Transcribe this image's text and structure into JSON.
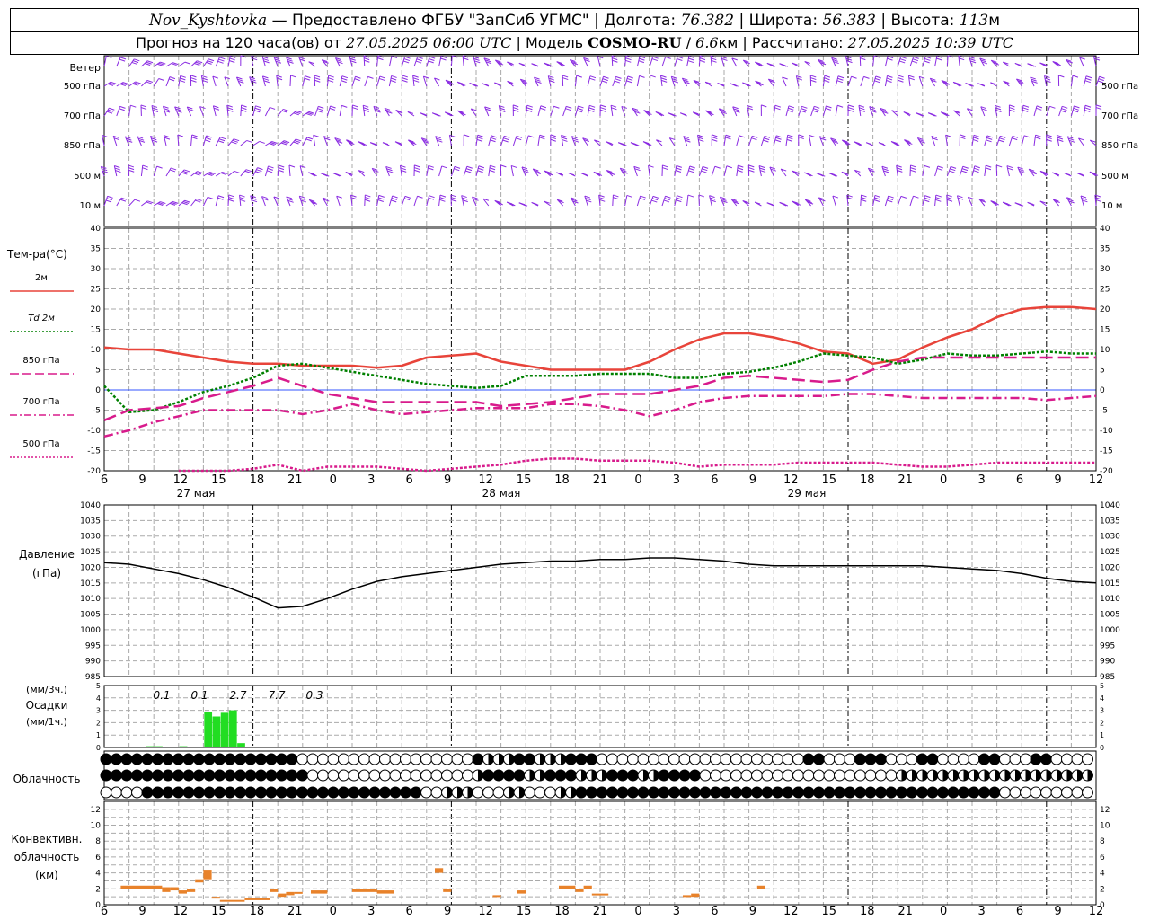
{
  "header": {
    "station": "Nov_Kyshtovka",
    "provider": "Предоставлено ФГБУ \"ЗапСиб УГМС\"",
    "lon_label": "Долгота:",
    "lon_value": "76.382",
    "lat_label": "Широта:",
    "lat_value": "56.383",
    "alt_label": "Высота:",
    "alt_value": "113",
    "alt_unit": "м",
    "forecast_label": "Прогноз на 120 часа(ов) от",
    "forecast_start": "27.05.2025 06:00 UTC",
    "model_label": "Модель",
    "model_name": "COSMO-RU",
    "model_res": "6.6",
    "model_res_unit": "км",
    "calc_label": "Рассчитано:",
    "calc_time": "27.05.2025 10:39 UTC"
  },
  "colors": {
    "wind": "#8a2be2",
    "t2m": "#e8443a",
    "td2m": "#008000",
    "t850": "#d81b8c",
    "t700": "#d81b8c",
    "t500": "#d81b8c",
    "pressure": "#000000",
    "precip": "#22dd22",
    "conv": "#e8822a",
    "zero_line": "#3355ff"
  },
  "wind_panel": {
    "title": "Ветер",
    "levels": [
      "500 гПа",
      "700 гПа",
      "850 гПа",
      "500 м",
      "10 м"
    ]
  },
  "temp_panel": {
    "title": "Тем-ра(°C)",
    "legend": [
      {
        "key": "t2m",
        "label": "2м",
        "style": "solid"
      },
      {
        "key": "td2m",
        "label": "Td 2м",
        "style": "dotted"
      },
      {
        "key": "t850",
        "label": "850 гПа",
        "style": "dash"
      },
      {
        "key": "t700",
        "label": "700 гПа",
        "style": "dashdot"
      },
      {
        "key": "t500",
        "label": "500 гПа",
        "style": "dotted"
      }
    ],
    "ticks": [
      "40",
      "35",
      "30",
      "25",
      "20",
      "15",
      "10",
      "5",
      "0",
      "-5",
      "-10",
      "-15",
      "-20"
    ]
  },
  "time_axis": {
    "hour_labels": [
      "6",
      "9",
      "12",
      "15",
      "18",
      "21",
      "0",
      "3",
      "6",
      "9",
      "12",
      "15",
      "18",
      "21",
      "0",
      "3",
      "6",
      "9",
      "12",
      "15",
      "18",
      "21",
      "0",
      "3",
      "6",
      "9",
      "12"
    ],
    "day_labels": [
      "27 мая",
      "28 мая",
      "29 мая"
    ]
  },
  "pressure_panel": {
    "title_line1": "Давление",
    "title_line2": "(гПа)",
    "ticks": [
      "1040",
      "1035",
      "1030",
      "1025",
      "1020",
      "1015",
      "1010",
      "1005",
      "1000",
      "995",
      "990",
      "985"
    ]
  },
  "precip_panel": {
    "title_line1": "(мм/3ч.)",
    "title_line2": "Осадки",
    "title_line3": "(мм/1ч.)",
    "ticks": [
      "5",
      "4",
      "3",
      "2",
      "1",
      "0"
    ],
    "totals": [
      "0.1",
      "0.1",
      "2.7",
      "7.7",
      "0.3"
    ]
  },
  "cloud_panel": {
    "title": "Облачность"
  },
  "conv_panel": {
    "title_line1": "Конвективн.",
    "title_line2": "облачность",
    "title_line3": "(км)",
    "ticks": [
      "12",
      "10",
      "8",
      "6",
      "4",
      "2",
      "0"
    ]
  },
  "chart_data": [
    {
      "type": "line",
      "title": "Тем-ра(°C)",
      "ylim": [
        -20,
        40
      ],
      "x_hours_from_start": [
        0,
        3,
        6,
        9,
        12,
        15,
        18,
        21,
        24,
        27,
        30,
        33,
        36,
        39,
        42,
        45,
        48,
        51,
        54,
        57,
        60,
        63,
        66,
        69,
        72,
        75,
        78,
        81,
        84,
        87,
        90,
        93,
        96,
        99,
        102,
        105,
        108,
        111,
        114,
        117,
        120
      ],
      "series": [
        {
          "name": "2м",
          "values": [
            10.5,
            10,
            10,
            9,
            8,
            7,
            6.5,
            6.5,
            6,
            6,
            6,
            5.5,
            6,
            8,
            8.5,
            9,
            7,
            6,
            5,
            5,
            5,
            5,
            7,
            10,
            12.5,
            14,
            14,
            13,
            11.5,
            9.5,
            9,
            6.5,
            7.5,
            10.5,
            13,
            15,
            18,
            20,
            20.5,
            20.5,
            20
          ]
        },
        {
          "name": "Td 2м",
          "values": [
            1,
            -5.5,
            -5,
            -3,
            -0.5,
            1,
            3,
            6,
            6.5,
            5.5,
            4.5,
            3.5,
            2.5,
            1.5,
            1,
            0.5,
            1,
            3.5,
            3.5,
            3.5,
            4,
            4,
            4,
            3,
            3,
            4,
            4.5,
            5.5,
            7,
            9,
            8.5,
            8,
            6.5,
            7.5,
            9,
            8.5,
            8.5,
            9,
            9.5,
            9,
            9
          ]
        },
        {
          "name": "850 гПа",
          "values": [
            -7.5,
            -5,
            -4.5,
            -4,
            -2,
            -0.5,
            1,
            3,
            1,
            -1,
            -2,
            -3,
            -3,
            -3,
            -3,
            -3,
            -4,
            -3.5,
            -3,
            -2,
            -1,
            -1,
            -1,
            0,
            1,
            3,
            3.5,
            3,
            2.5,
            2,
            2.5,
            5,
            7,
            8,
            8,
            8,
            8,
            8,
            8,
            8,
            8
          ]
        },
        {
          "name": "700 гПа",
          "values": [
            -11.5,
            -10,
            -8,
            -6.5,
            -5,
            -5,
            -5,
            -5,
            -6,
            -5,
            -3.5,
            -5,
            -6,
            -5.5,
            -5,
            -4.5,
            -4.5,
            -4.5,
            -3.5,
            -3.5,
            -4,
            -5,
            -6.5,
            -5,
            -3,
            -2,
            -1.5,
            -1.5,
            -1.5,
            -1.5,
            -1,
            -1,
            -1.5,
            -2,
            -2,
            -2,
            -2,
            -2,
            -2.5,
            -2,
            -1.5
          ]
        },
        {
          "name": "500 гПа",
          "values": [
            null,
            null,
            null,
            -20,
            -20,
            -20,
            -19.5,
            -18.5,
            -20,
            -19,
            -19,
            -19,
            -19.5,
            -20,
            -19.5,
            -19,
            -18.5,
            -17.5,
            -17,
            -17,
            -17.5,
            -17.5,
            -17.5,
            -18,
            -19,
            -18.5,
            -18.5,
            -18.5,
            -18,
            -18,
            -18,
            -18,
            -18.5,
            -19,
            -19,
            -18.5,
            -18,
            -18,
            -18,
            -18,
            -18
          ]
        }
      ]
    },
    {
      "type": "line",
      "title": "Давление (гПа)",
      "ylim": [
        985,
        1040
      ],
      "x_hours_from_start": [
        0,
        3,
        6,
        9,
        12,
        15,
        18,
        21,
        24,
        27,
        30,
        33,
        36,
        39,
        42,
        45,
        48,
        51,
        54,
        57,
        60,
        63,
        66,
        69,
        72,
        75,
        78,
        81,
        84,
        87,
        90,
        93,
        96,
        99,
        102,
        105,
        108,
        111,
        114,
        117,
        120
      ],
      "series": [
        {
          "name": "",
          "values": [
            1021.5,
            1021,
            1019.5,
            1018,
            1016,
            1013.5,
            1010.5,
            1007,
            1007.5,
            1010,
            1013,
            1015.5,
            1017,
            1018,
            1019,
            1020,
            1021,
            1021.5,
            1022,
            1022,
            1022.5,
            1022.5,
            1023,
            1023,
            1022.5,
            1022,
            1021,
            1020.5,
            1020.5,
            1020.5,
            1020.5,
            1020.5,
            1020.5,
            1020.5,
            1020,
            1019.5,
            1019,
            1018,
            1016.5,
            1015.5,
            1015
          ]
        }
      ]
    },
    {
      "type": "bar",
      "title": "Осадки",
      "ylim": [
        0,
        5
      ],
      "x_hours_from_start": [
        0,
        1,
        2,
        3,
        4,
        5,
        6,
        7,
        8,
        9,
        10,
        11,
        12,
        13,
        14,
        15,
        16,
        17,
        18
      ],
      "values": [
        0,
        0,
        0,
        0,
        0,
        0.1,
        0.1,
        0.05,
        0,
        0.1,
        0.05,
        0,
        2.9,
        2.5,
        2.8,
        3,
        0.35,
        0.05,
        0
      ],
      "totals_3h": [
        {
          "hours": "9",
          "value": 0.1
        },
        {
          "hours": "12",
          "value": 0.1
        },
        {
          "hours": "15",
          "value": 2.7
        },
        {
          "hours": "18",
          "value": 7.7
        },
        {
          "hours": "21",
          "value": 0.3
        }
      ]
    },
    {
      "type": "bar",
      "title": "Конвективн. облачность (км)",
      "ylim": [
        0,
        12
      ],
      "segments_hours_from_start": [
        {
          "h0": 2,
          "h1": 7,
          "base": 2.0,
          "top": 2.4
        },
        {
          "h0": 7,
          "h1": 8,
          "base": 1.6,
          "top": 2.2
        },
        {
          "h0": 8,
          "h1": 9,
          "base": 1.8,
          "top": 2.2
        },
        {
          "h0": 9,
          "h1": 10,
          "base": 1.4,
          "top": 1.8
        },
        {
          "h0": 10,
          "h1": 11,
          "base": 1.6,
          "top": 2.0
        },
        {
          "h0": 11,
          "h1": 12,
          "base": 2.8,
          "top": 3.2
        },
        {
          "h0": 12,
          "h1": 13,
          "base": 3.2,
          "top": 4.4
        },
        {
          "h0": 13,
          "h1": 14,
          "base": 0.8,
          "top": 1.0
        },
        {
          "h0": 14,
          "h1": 17,
          "base": 0.4,
          "top": 0.6
        },
        {
          "h0": 17,
          "h1": 20,
          "base": 0.6,
          "top": 0.8
        },
        {
          "h0": 20,
          "h1": 21,
          "base": 1.6,
          "top": 2.0
        },
        {
          "h0": 21,
          "h1": 22,
          "base": 1.0,
          "top": 1.4
        },
        {
          "h0": 22,
          "h1": 23,
          "base": 1.2,
          "top": 1.6
        },
        {
          "h0": 23,
          "h1": 24,
          "base": 1.4,
          "top": 1.6
        },
        {
          "h0": 25,
          "h1": 27,
          "base": 1.4,
          "top": 1.8
        },
        {
          "h0": 30,
          "h1": 33,
          "base": 1.6,
          "top": 2.0
        },
        {
          "h0": 33,
          "h1": 35,
          "base": 1.4,
          "top": 1.8
        },
        {
          "h0": 40,
          "h1": 41,
          "base": 4.0,
          "top": 4.6
        },
        {
          "h0": 41,
          "h1": 42,
          "base": 1.6,
          "top": 2.0
        },
        {
          "h0": 47,
          "h1": 48,
          "base": 1.0,
          "top": 1.2
        },
        {
          "h0": 50,
          "h1": 51,
          "base": 1.4,
          "top": 1.8
        },
        {
          "h0": 55,
          "h1": 57,
          "base": 2.0,
          "top": 2.4
        },
        {
          "h0": 57,
          "h1": 58,
          "base": 1.6,
          "top": 2.0
        },
        {
          "h0": 58,
          "h1": 59,
          "base": 2.0,
          "top": 2.4
        },
        {
          "h0": 59,
          "h1": 61,
          "base": 1.2,
          "top": 1.4
        },
        {
          "h0": 70,
          "h1": 71,
          "base": 1.0,
          "top": 1.2
        },
        {
          "h0": 71,
          "h1": 72,
          "base": 1.0,
          "top": 1.4
        },
        {
          "h0": 79,
          "h1": 80,
          "base": 2.0,
          "top": 2.4
        }
      ]
    }
  ]
}
